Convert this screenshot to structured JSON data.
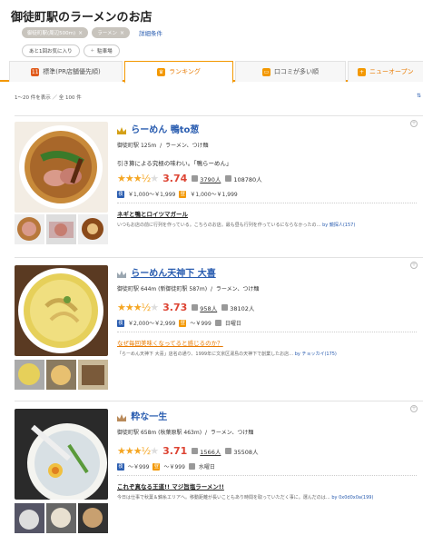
{
  "page_title": "御徒町駅のラーメンのお店",
  "filters": {
    "chips": [
      "御徒町駅(周辺500m)",
      "ラーメン"
    ],
    "chip_close": "×",
    "condition_link": "詳細条件",
    "options": [
      "あと1回お気に入り",
      "駐車場"
    ]
  },
  "tabs": [
    {
      "label": "標準(PR店舗優先順)",
      "icon": "11"
    },
    {
      "label": "ランキング",
      "icon": "crown"
    },
    {
      "label": "口コミが多い順",
      "icon": "chat"
    },
    {
      "label": "ニューオープン",
      "icon": "new"
    }
  ],
  "result_count": "1～20 件を表示 ／ 全 100 件",
  "restaurants": [
    {
      "name": "らーめん 鴨to葱",
      "station": "御徒町駅",
      "distance": "125m",
      "genres": "ラーメン、つけ麺",
      "description": "引き算による究極の味わい。「鴨らーめん」",
      "stars": 3.5,
      "score": "3.74",
      "reviews": "3790人",
      "bookmarks": "108780人",
      "dinner": "￥1,000～￥1,999",
      "lunch": "￥1,000～￥1,999",
      "holiday": "",
      "review_title": "ネギと鴨とロイツマガール",
      "review_body": "いつもお店の前に行列を作っている。こちらのお店。最も昼も行列を作っているにならなかったの…",
      "review_author": "by 鏡探人(157)",
      "accent": "#8b5a2b"
    },
    {
      "name": "らーめん天神下 大喜",
      "station": "御徒町駅",
      "distance": "644m",
      "distance_note": "(新御徒町駅 587m)",
      "genres": "ラーメン、つけ麺",
      "description": "",
      "stars": 3.5,
      "score": "3.73",
      "reviews": "958人",
      "bookmarks": "38102人",
      "dinner": "￥2,000～￥2,999",
      "lunch": "～￥999",
      "holiday": "日曜日",
      "review_title": "なぜ毎回美味くなってると感じるのか？",
      "review_body": "「らーめん天神下 大喜」店名の通り、1999年に文京区湯島の天神下で創業したお店…",
      "review_author": "by チョッカイ(175)",
      "accent": "#e6c95a"
    },
    {
      "name": "粋な一生",
      "station": "御徒町駅",
      "distance": "658m",
      "distance_note": "(秋葉原駅 463m)",
      "genres": "ラーメン、つけ麺",
      "description": "",
      "stars": 3.5,
      "score": "3.71",
      "reviews": "1566人",
      "bookmarks": "35508人",
      "dinner": "～￥999",
      "lunch": "～￥999",
      "holiday": "水曜日",
      "review_title": "これぞ真なる王道!! マジ旨塩ラーメン!!",
      "review_body": "今日は仕事で秋葉＆錦糸エリアへ。移動距離が長いこともあり時間を取っていただく事に。選んだのは…",
      "review_author": "by 0x0d0x0a(199)",
      "accent": "#c7d0d6"
    }
  ],
  "labels": {
    "dinner_mark": "夜",
    "lunch_mark": "昼",
    "sep": "/",
    "plus": "+",
    "currency_sort": "⇅"
  },
  "colors": {
    "accent_orange": "#f39800",
    "link_blue": "#2a5db0",
    "score_red": "#d43",
    "dinner_blue": "#2a5db0",
    "lunch_orange": "#f39800"
  }
}
